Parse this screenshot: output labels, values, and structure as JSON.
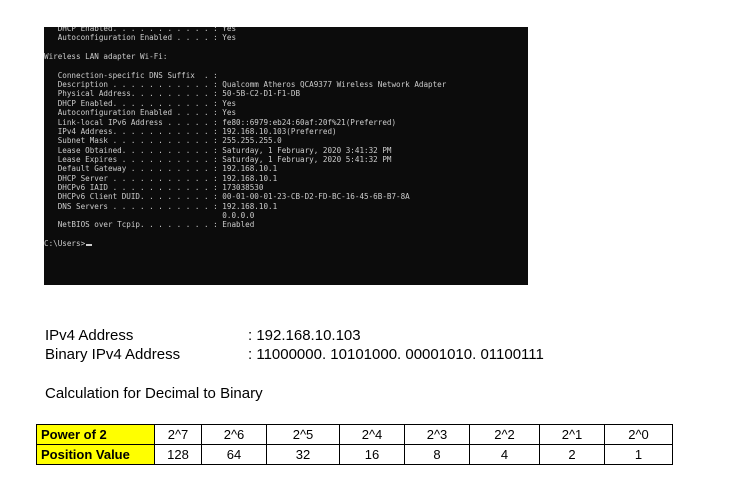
{
  "terminal": {
    "lines": [
      "   DHCP Enabled. . . . . . . . . . . : Yes",
      "   Autoconfiguration Enabled . . . . : Yes",
      "",
      "Wireless LAN adapter Wi-Fi:",
      "",
      "   Connection-specific DNS Suffix  . :",
      "   Description . . . . . . . . . . . : Qualcomm Atheros QCA9377 Wireless Network Adapter",
      "   Physical Address. . . . . . . . . : 50-5B-C2-D1-F1-DB",
      "   DHCP Enabled. . . . . . . . . . . : Yes",
      "   Autoconfiguration Enabled . . . . : Yes",
      "   Link-local IPv6 Address . . . . . : fe80::6979:eb24:60af:20f%21(Preferred)",
      "   IPv4 Address. . . . . . . . . . . : 192.168.10.103(Preferred)",
      "   Subnet Mask . . . . . . . . . . . : 255.255.255.0",
      "   Lease Obtained. . . . . . . . . . : Saturday, 1 February, 2020 3:41:32 PM",
      "   Lease Expires . . . . . . . . . . : Saturday, 1 February, 2020 5:41:32 PM",
      "   Default Gateway . . . . . . . . . : 192.168.10.1",
      "   DHCP Server . . . . . . . . . . . : 192.168.10.1",
      "   DHCPv6 IAID . . . . . . . . . . . : 173038530",
      "   DHCPv6 Client DUID. . . . . . . . : 00-01-00-01-23-CB-D2-FD-BC-16-45-6B-B7-8A",
      "   DNS Servers . . . . . . . . . . . : 192.168.10.1",
      "                                       0.0.0.0",
      "   NetBIOS over Tcpip. . . . . . . . : Enabled",
      "",
      "C:\\Users>"
    ]
  },
  "info": {
    "ipv4_label": "IPv4 Address",
    "ipv4_value": ": 192.168.10.103",
    "binary_label": "Binary IPv4 Address",
    "binary_value": ": 11000000. 10101000. 00001010. 01100111"
  },
  "calc_title": "Calculation for Decimal to Binary",
  "table": {
    "power_label": "Power of 2",
    "position_label": "Position Value",
    "powers": [
      "2^7",
      "2^6",
      "2^5",
      "2^4",
      "2^3",
      "2^2",
      "2^1",
      "2^0"
    ],
    "values": [
      "128",
      "64",
      "32",
      "16",
      "8",
      "4",
      "2",
      "1"
    ],
    "header_color": "#ffff00"
  }
}
